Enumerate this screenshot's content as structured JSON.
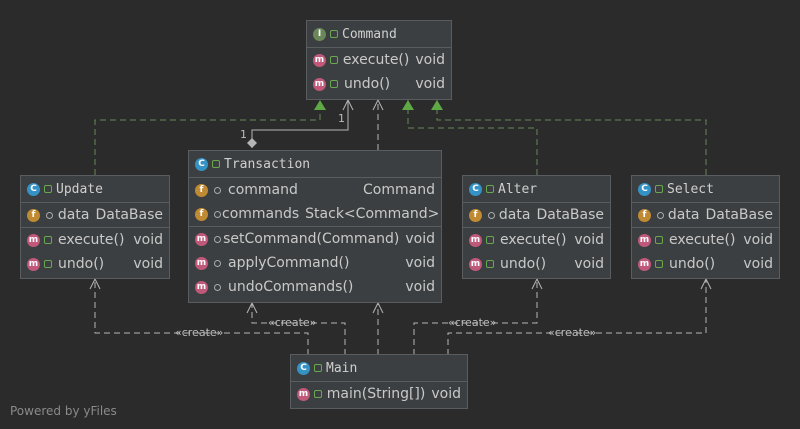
{
  "colors": {
    "background": "#2b2b2b",
    "box": "#3c3f41",
    "edge": "#b5b5b5",
    "realization": "#6a8759",
    "arrowhead": "#5fa846"
  },
  "nodes": {
    "command": {
      "title": "Command",
      "kind_badge": "I",
      "methods": [
        {
          "name": "execute()",
          "type": "void"
        },
        {
          "name": "undo()",
          "type": "void"
        }
      ]
    },
    "transaction": {
      "title": "Transaction",
      "kind_badge": "C",
      "fields": [
        {
          "name": "command",
          "type": "Command"
        },
        {
          "name": "commands",
          "type": "Stack<Command>"
        }
      ],
      "methods": [
        {
          "name": "setCommand(Command)",
          "type": "void"
        },
        {
          "name": "applyCommand()",
          "type": "void"
        },
        {
          "name": "undoCommands()",
          "type": "void"
        }
      ]
    },
    "update": {
      "title": "Update",
      "kind_badge": "C",
      "fields": [
        {
          "name": "data",
          "type": "DataBase"
        }
      ],
      "methods": [
        {
          "name": "execute()",
          "type": "void"
        },
        {
          "name": "undo()",
          "type": "void"
        }
      ]
    },
    "alter": {
      "title": "Alter",
      "kind_badge": "C",
      "fields": [
        {
          "name": "data",
          "type": "DataBase"
        }
      ],
      "methods": [
        {
          "name": "execute()",
          "type": "void"
        },
        {
          "name": "undo()",
          "type": "void"
        }
      ]
    },
    "select": {
      "title": "Select",
      "kind_badge": "C",
      "fields": [
        {
          "name": "data",
          "type": "DataBase"
        }
      ],
      "methods": [
        {
          "name": "execute()",
          "type": "void"
        },
        {
          "name": "undo()",
          "type": "void"
        }
      ]
    },
    "main": {
      "title": "Main",
      "kind_badge": "C",
      "methods": [
        {
          "name": "main(String[])",
          "type": "void"
        }
      ]
    }
  },
  "edge_labels": {
    "multiplicity_command": "1",
    "multiplicity_transaction": "1",
    "create_update": "«create»",
    "create_transaction": "«create»",
    "create_alter": "«create»",
    "create_select": "«create»"
  },
  "footer": "Powered by yFiles"
}
